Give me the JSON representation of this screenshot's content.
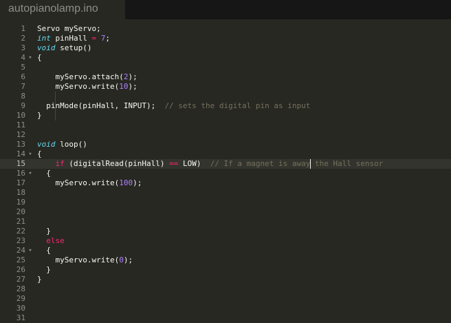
{
  "tab": {
    "filename": "autopianolamp.ino"
  },
  "editor": {
    "active_line": 15,
    "lines": [
      {
        "n": "1",
        "fold": "",
        "tokens": [
          [
            "plain",
            "Servo myServo;"
          ]
        ]
      },
      {
        "n": "2",
        "fold": "",
        "tokens": [
          [
            "type",
            "int"
          ],
          [
            "plain",
            " pinHall "
          ],
          [
            "kw",
            "="
          ],
          [
            "plain",
            " "
          ],
          [
            "num",
            "7"
          ],
          [
            "plain",
            ";"
          ]
        ]
      },
      {
        "n": "3",
        "fold": "",
        "tokens": [
          [
            "type",
            "void"
          ],
          [
            "plain",
            " setup()"
          ]
        ]
      },
      {
        "n": "4",
        "fold": "▾",
        "tokens": [
          [
            "plain",
            "{"
          ]
        ]
      },
      {
        "n": "5",
        "fold": "",
        "tokens": []
      },
      {
        "n": "6",
        "fold": "",
        "tokens": [
          [
            "plain",
            "    myServo.attach("
          ],
          [
            "num",
            "2"
          ],
          [
            "plain",
            ");"
          ]
        ]
      },
      {
        "n": "7",
        "fold": "",
        "tokens": [
          [
            "plain",
            "    myServo.write("
          ],
          [
            "num",
            "10"
          ],
          [
            "plain",
            ");"
          ]
        ]
      },
      {
        "n": "8",
        "fold": "",
        "tokens": []
      },
      {
        "n": "9",
        "fold": "",
        "tokens": [
          [
            "plain",
            "  pinMode(pinHall, INPUT);  "
          ],
          [
            "com",
            "// sets the digital pin as input"
          ]
        ]
      },
      {
        "n": "10",
        "fold": "",
        "tokens": [
          [
            "plain",
            "}"
          ]
        ]
      },
      {
        "n": "11",
        "fold": "",
        "tokens": []
      },
      {
        "n": "12",
        "fold": "",
        "tokens": []
      },
      {
        "n": "13",
        "fold": "",
        "tokens": [
          [
            "type",
            "void"
          ],
          [
            "plain",
            " loop()"
          ]
        ]
      },
      {
        "n": "14",
        "fold": "▾",
        "tokens": [
          [
            "plain",
            "{"
          ]
        ]
      },
      {
        "n": "15",
        "fold": "",
        "tokens": [
          [
            "plain",
            "    "
          ],
          [
            "kw",
            "if"
          ],
          [
            "plain",
            " (digitalRead(pinHall) "
          ],
          [
            "kw",
            "=="
          ],
          [
            "plain",
            " LOW)  "
          ],
          [
            "com",
            "// If a magnet is away the Hall sensor"
          ]
        ]
      },
      {
        "n": "16",
        "fold": "▾",
        "tokens": [
          [
            "plain",
            "  {"
          ]
        ]
      },
      {
        "n": "17",
        "fold": "",
        "tokens": [
          [
            "plain",
            "    myServo.write("
          ],
          [
            "num",
            "100"
          ],
          [
            "plain",
            ");"
          ]
        ]
      },
      {
        "n": "18",
        "fold": "",
        "tokens": []
      },
      {
        "n": "19",
        "fold": "",
        "tokens": []
      },
      {
        "n": "20",
        "fold": "",
        "tokens": []
      },
      {
        "n": "21",
        "fold": "",
        "tokens": []
      },
      {
        "n": "22",
        "fold": "",
        "tokens": [
          [
            "plain",
            "  }"
          ]
        ]
      },
      {
        "n": "23",
        "fold": "",
        "tokens": [
          [
            "plain",
            "  "
          ],
          [
            "kw",
            "else"
          ]
        ]
      },
      {
        "n": "24",
        "fold": "▾",
        "tokens": [
          [
            "plain",
            "  {"
          ]
        ]
      },
      {
        "n": "25",
        "fold": "",
        "tokens": [
          [
            "plain",
            "    myServo.write("
          ],
          [
            "num",
            "0"
          ],
          [
            "plain",
            ");"
          ]
        ]
      },
      {
        "n": "26",
        "fold": "",
        "tokens": [
          [
            "plain",
            "  }"
          ]
        ]
      },
      {
        "n": "27",
        "fold": "",
        "tokens": [
          [
            "plain",
            "}"
          ]
        ]
      },
      {
        "n": "28",
        "fold": "",
        "tokens": []
      },
      {
        "n": "29",
        "fold": "",
        "tokens": []
      },
      {
        "n": "30",
        "fold": "",
        "tokens": []
      },
      {
        "n": "31",
        "fold": "",
        "tokens": []
      }
    ]
  },
  "colors": {
    "background": "#272822",
    "tabbar": "#161616",
    "keyword": "#f92672",
    "type": "#66d9ef",
    "number": "#ae81ff",
    "comment": "#75715e",
    "text": "#f8f8f2"
  }
}
